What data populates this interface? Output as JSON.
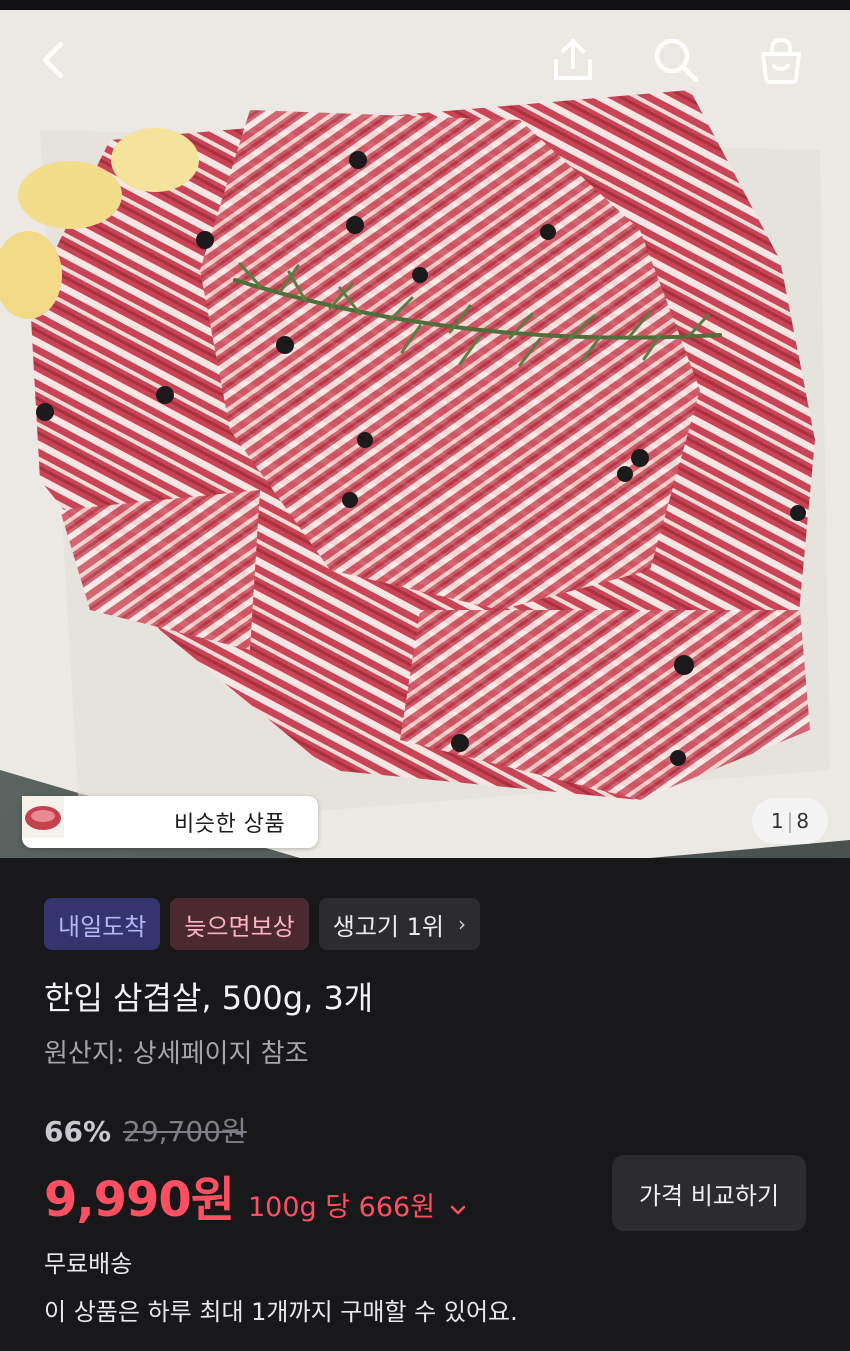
{
  "header": {
    "back_icon": "chevron-left-icon",
    "share_icon": "share-icon",
    "search_icon": "search-icon",
    "cart_icon": "shopping-bag-icon"
  },
  "gallery": {
    "image_alt": "한입 삼겹살",
    "similar_label": "비슷한 상품",
    "counter_current": "1",
    "counter_total": "8"
  },
  "badges": {
    "tomorrow": "내일도착",
    "late_comp": "늦으면보상",
    "rank": "생고기 1위"
  },
  "product": {
    "title": "한입 삼겹살, 500g, 3개",
    "origin": "원산지: 상세페이지 참조"
  },
  "pricing": {
    "discount": "66%",
    "original_price": "29,700원",
    "sale_price": "9,990원",
    "unit_price": "100g 당 666원",
    "compare_label": "가격 비교하기"
  },
  "shipping": {
    "label": "무료배송",
    "purchase_limit": "이 상품은 하루 최대 1개까지 구매할 수 있어요."
  },
  "colors": {
    "background": "#18181b",
    "price_red": "#ff4f62",
    "tag_tomorrow_bg": "#34356c",
    "tag_late_bg": "#4a2a2f"
  }
}
